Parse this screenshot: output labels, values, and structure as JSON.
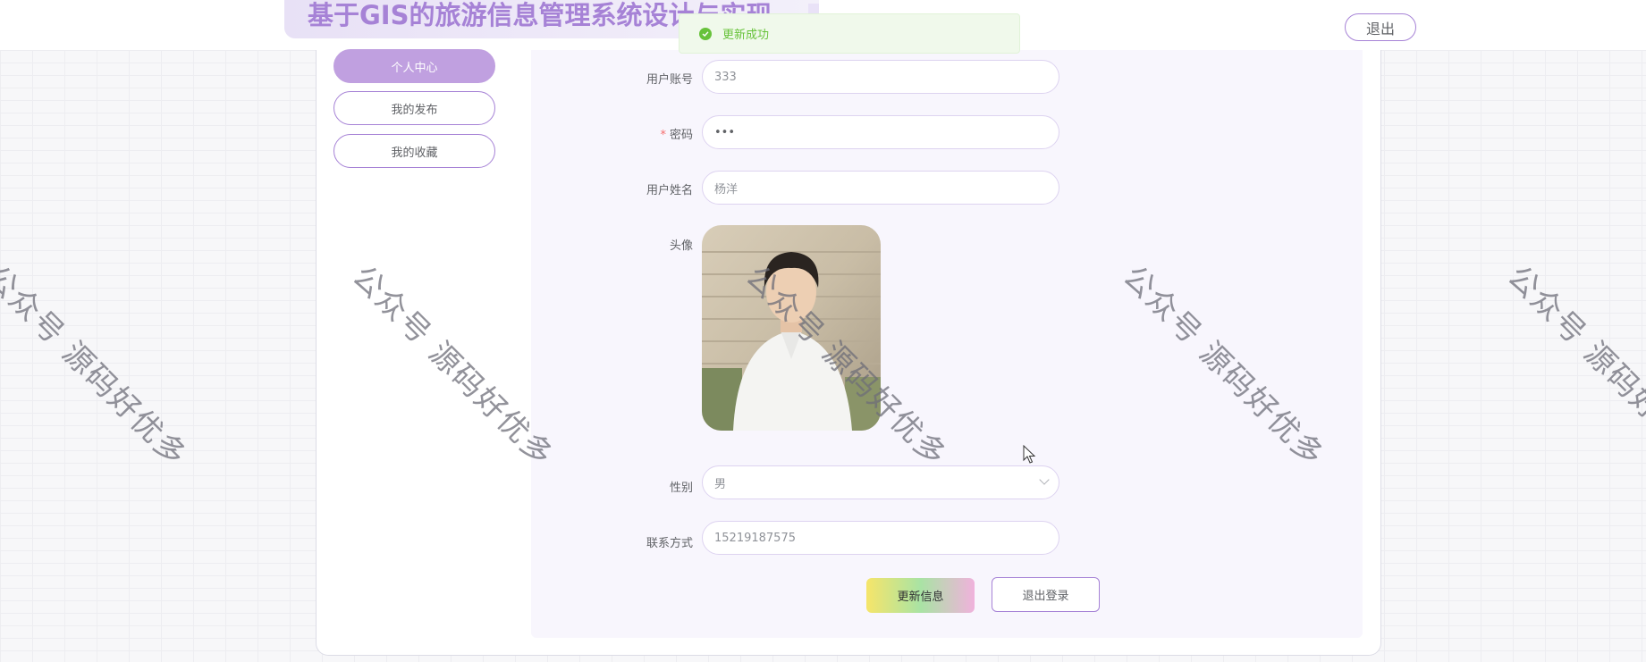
{
  "header": {
    "title": "基于GIS的旅游信息管理系统设计与实现",
    "logout_label": "退出"
  },
  "toast": {
    "message": "更新成功",
    "icon": "check-circle-icon"
  },
  "sidebar": {
    "items": [
      {
        "label": "个人中心",
        "active": true
      },
      {
        "label": "我的发布",
        "active": false
      },
      {
        "label": "我的收藏",
        "active": false
      }
    ]
  },
  "form": {
    "account": {
      "label": "用户账号",
      "value": "333"
    },
    "password": {
      "label": "密码",
      "required_mark": "*",
      "value": "•••"
    },
    "name": {
      "label": "用户姓名",
      "value": "杨洋"
    },
    "avatar": {
      "label": "头像"
    },
    "gender": {
      "label": "性别",
      "value": "男"
    },
    "phone": {
      "label": "联系方式",
      "value": "15219187575"
    }
  },
  "actions": {
    "update_label": "更新信息",
    "logout_label": "退出登录"
  },
  "watermark": {
    "text": "公众号 源码好优多"
  },
  "colors": {
    "accent": "#a682d6",
    "active_menu": "#c0a0e0",
    "success": "#67c23a",
    "required": "#f56c6c"
  }
}
